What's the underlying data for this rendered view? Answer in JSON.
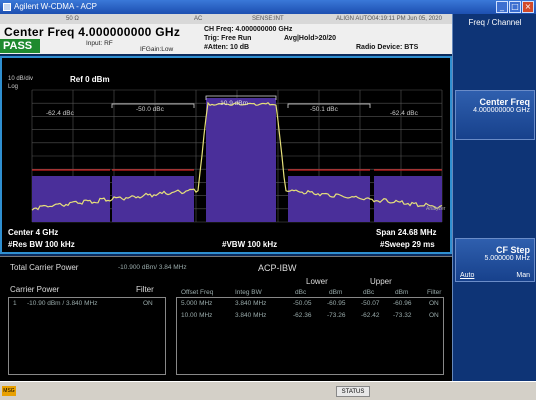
{
  "window": {
    "title": "Agilent W-CDMA - ACP",
    "min_label": "_",
    "max_label": "□",
    "close_label": "×"
  },
  "status_strip": {
    "item1": "50 Ω",
    "item2": "AC",
    "item3": "SENSE:INT",
    "item4": "ALIGN AUTO",
    "datetime": "04:19:11 PM Jun 05, 2020"
  },
  "header": {
    "center_freq": "Center Freq  4.000000000 GHz",
    "pass": "PASS",
    "input": "Input: RF",
    "if_gain": "IFGain:Low",
    "ch_freq": "CH Freq: 4.000000000 GHz",
    "trig": "Trig: Free Run",
    "avg_hold": "Avg|Hold>20/20",
    "atten": "#Atten: 10 dB",
    "radio_device": "Radio Device: BTS"
  },
  "plot": {
    "scale": "10 dB/div",
    "log": "Log",
    "ref": "Ref  0 dBm",
    "seg_labels": [
      "-62.4 dBc",
      "-50.0 dBc",
      "-10.9 dBm",
      "-50.1 dBc",
      "-62.4 dBc"
    ],
    "annot": "Analyzer",
    "center": "Center  4 GHz",
    "res_bw": "#Res BW  100 kHz",
    "vbw": "#VBW  100 kHz",
    "span": "Span 24.68 MHz",
    "sweep": "#Sweep  29 ms"
  },
  "results": {
    "total_carrier_label": "Total Carrier Power",
    "total_carrier_value": "-10.900 dBm/ 3.84 MHz",
    "acp_title": "ACP-IBW",
    "carrier_power_label": "Carrier Power",
    "filter_label": "Filter",
    "carrier_row": {
      "index": "1",
      "value": "-10.90 dBm / 3.840 MHz",
      "filter": "ON"
    },
    "col_headers": [
      "Offset Freq",
      "Integ BW",
      "dBc",
      "dBm",
      "dBc",
      "dBm",
      "Filter"
    ],
    "lower_label": "Lower",
    "upper_label": "Upper",
    "rows": [
      [
        "5.000 MHz",
        "3.840 MHz",
        "-50.05",
        "-60.95",
        "-50.07",
        "-60.96",
        "ON"
      ],
      [
        "10.00 MHz",
        "3.840 MHz",
        "-62.36",
        "-73.26",
        "-62.42",
        "-73.32",
        "ON"
      ]
    ]
  },
  "side_panel": {
    "title": "Freq / Channel",
    "center_freq_label": "Center Freq",
    "center_freq_value": "4.000000000 GHz",
    "cf_step_label": "CF Step",
    "cf_step_value": "5.000000 MHz",
    "cf_step_auto": "Auto",
    "cf_step_man": "Man"
  },
  "taskbar": {
    "msg": "MSG",
    "status": "STATUS"
  },
  "colors": {
    "trace": "#e6e07a",
    "channel_fill": "#4a2f9a",
    "limit_line": "#d02020",
    "pass": "#1f8a2e"
  }
}
